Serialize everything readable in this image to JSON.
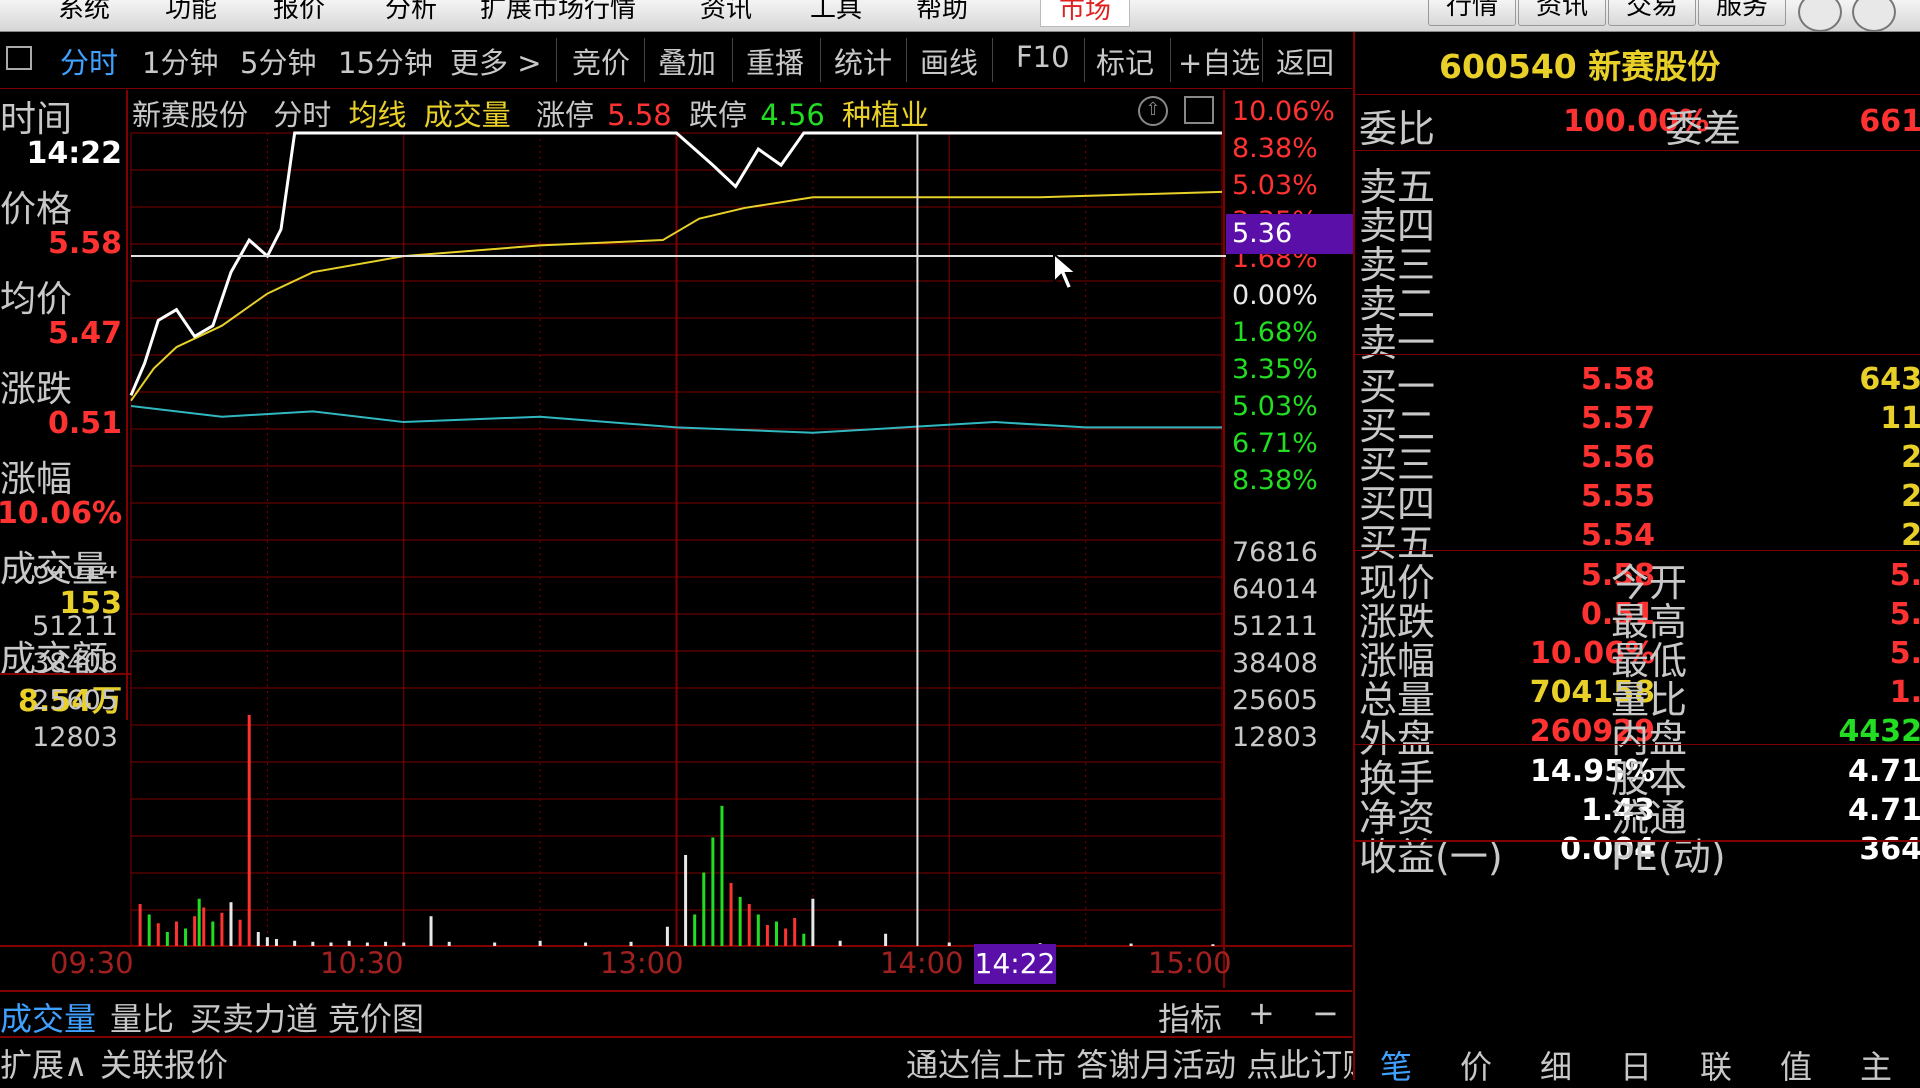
{
  "menubar": {
    "items": [
      "系统",
      "功能",
      "报价",
      "分析",
      "扩展市场行情",
      "资讯",
      "工具",
      "帮助",
      "市场"
    ],
    "right_buttons": [
      "行情",
      "资讯",
      "交易",
      "服务"
    ]
  },
  "toolbar": {
    "items": [
      "分时",
      "1分钟",
      "5分钟",
      "15分钟",
      "更多 >",
      "竞价",
      "叠加",
      "重播",
      "统计",
      "画线",
      "F10",
      "标记",
      "+自选",
      "返回"
    ]
  },
  "left_panel": {
    "time_label": "时间",
    "time_value": "14:22",
    "price_label": "价格",
    "price_value": "5.58",
    "avg_label": "均价",
    "avg_value": "5.47",
    "change_label": "涨跌",
    "change_value": "0.51",
    "pct_label": "涨幅",
    "pct_value": "10.06%",
    "vol_label": "成交量",
    "vol_value": "153",
    "amt_label": "成交额",
    "amt_value": "8.54万"
  },
  "chart_header": {
    "name": "新赛股份",
    "mode": "分时",
    "avg_line": "均线",
    "volume": "成交量",
    "limit_up_label": "涨停",
    "limit_up_value": "5.58",
    "limit_down_label": "跌停",
    "limit_down_value": "4.56",
    "industry": "种植业"
  },
  "cursor_price_label": "5.36",
  "cursor_time_label": "14:22",
  "price_axis_pcts": [
    {
      "text": "10.06%",
      "color": "red"
    },
    {
      "text": "8.38%",
      "color": "red"
    },
    {
      "text": "5.03%",
      "color": "red"
    },
    {
      "text": "3.35%",
      "color": "red"
    },
    {
      "text": "1.68%",
      "color": "red"
    },
    {
      "text": "0.00%",
      "color": "white"
    },
    {
      "text": "1.68%",
      "color": "green"
    },
    {
      "text": "3.35%",
      "color": "green"
    },
    {
      "text": "5.03%",
      "color": "green"
    },
    {
      "text": "6.71%",
      "color": "green"
    },
    {
      "text": "8.38%",
      "color": "green"
    }
  ],
  "volume_axis_right": [
    "76816",
    "64014",
    "51211",
    "38408",
    "25605",
    "12803"
  ],
  "volume_axis_left": [
    "64014",
    "51211",
    "38408",
    "25605",
    "12803"
  ],
  "time_axis": [
    "09:30",
    "10:30",
    "13:00",
    "14:00",
    "15:00"
  ],
  "bottom_tabs": [
    "成交量",
    "量比",
    "买卖力道",
    "竞价图"
  ],
  "bottom_right": {
    "indicator": "指标",
    "plus": "+",
    "minus": "−"
  },
  "status_bar": {
    "expand": "扩展∧",
    "related": "关联报价",
    "ad": "通达信上市 答谢月活动 点此订购"
  },
  "right_panel": {
    "code": "600540",
    "name": "新赛股份",
    "ratio_label": "委比",
    "ratio_value": "100.00%",
    "diff_label": "委差",
    "diff_value": "661",
    "sells": [
      "卖五",
      "卖四",
      "卖三",
      "卖二",
      "卖一"
    ],
    "buys": [
      {
        "label": "买一",
        "price": "5.58",
        "vol": "643"
      },
      {
        "label": "买二",
        "price": "5.57",
        "vol": "11"
      },
      {
        "label": "买三",
        "price": "5.56",
        "vol": "2"
      },
      {
        "label": "买四",
        "price": "5.55",
        "vol": "2"
      },
      {
        "label": "买五",
        "price": "5.54",
        "vol": "2"
      }
    ],
    "stats": [
      {
        "l1": "现价",
        "v1": "5.58",
        "l2": "今开",
        "v2": "5.",
        "c1": "red",
        "c2": "red"
      },
      {
        "l1": "涨跌",
        "v1": "0.51",
        "l2": "最高",
        "v2": "5.",
        "c1": "red",
        "c2": "red"
      },
      {
        "l1": "涨幅",
        "v1": "10.06%",
        "l2": "最低",
        "v2": "5.",
        "c1": "red",
        "c2": "red"
      },
      {
        "l1": "总量",
        "v1": "704158",
        "l2": "量比",
        "v2": "1.",
        "c1": "yellow",
        "c2": "red"
      },
      {
        "l1": "外盘",
        "v1": "260929",
        "l2": "内盘",
        "v2": "4432",
        "c1": "red",
        "c2": "green"
      }
    ],
    "fund": [
      {
        "l1": "换手",
        "v1": "14.95%",
        "l2": "股本",
        "v2": "4.71"
      },
      {
        "l1": "净资",
        "v1": "1.43",
        "l2": "流通",
        "v2": "4.71"
      },
      {
        "l1": "收益(一)",
        "v1": "0.004",
        "l2": "PE(动)",
        "v2": "364"
      }
    ],
    "bottom_tabs": [
      "笔",
      "价",
      "细",
      "日",
      "联",
      "值",
      "主"
    ]
  },
  "chart_data": {
    "type": "line",
    "title": "",
    "prev_close": 5.07,
    "ylim": [
      4.56,
      5.58
    ],
    "x_ticks": [
      "09:30",
      "10:30",
      "13:00",
      "14:00",
      "15:00"
    ],
    "series": [
      {
        "name": "",
        "color": "#ffffff",
        "points": [
          [
            0,
            5.09
          ],
          [
            3,
            5.15
          ],
          [
            6,
            5.23
          ],
          [
            10,
            5.25
          ],
          [
            14,
            5.2
          ],
          [
            18,
            5.22
          ],
          [
            22,
            5.32
          ],
          [
            26,
            5.38
          ],
          [
            30,
            5.35
          ],
          [
            33,
            5.4
          ],
          [
            36,
            5.58
          ],
          [
            60,
            5.58
          ],
          [
            120,
            5.58
          ],
          [
            128,
            5.52
          ],
          [
            133,
            5.48
          ],
          [
            138,
            5.55
          ],
          [
            143,
            5.52
          ],
          [
            148,
            5.58
          ],
          [
            240,
            5.58
          ]
        ]
      },
      {
        "name": "均线",
        "color": "#e8d028",
        "points": [
          [
            0,
            5.08
          ],
          [
            5,
            5.14
          ],
          [
            10,
            5.18
          ],
          [
            20,
            5.22
          ],
          [
            30,
            5.28
          ],
          [
            40,
            5.32
          ],
          [
            60,
            5.35
          ],
          [
            90,
            5.37
          ],
          [
            117,
            5.38
          ],
          [
            125,
            5.42
          ],
          [
            135,
            5.44
          ],
          [
            150,
            5.46
          ],
          [
            200,
            5.46
          ],
          [
            240,
            5.47
          ]
        ]
      }
    ],
    "index_series": {
      "color": "#30b8c0",
      "points": [
        [
          0,
          5.07
        ],
        [
          20,
          5.05
        ],
        [
          40,
          5.06
        ],
        [
          60,
          5.04
        ],
        [
          90,
          5.05
        ],
        [
          120,
          5.03
        ],
        [
          150,
          5.02
        ],
        [
          170,
          5.03
        ],
        [
          190,
          5.04
        ],
        [
          210,
          5.03
        ],
        [
          240,
          5.03
        ]
      ]
    },
    "volume": {
      "ylim": [
        0,
        76816
      ],
      "bars": [
        [
          2,
          12000,
          "r"
        ],
        [
          4,
          9000,
          "g"
        ],
        [
          6,
          6500,
          "r"
        ],
        [
          8,
          4000,
          "g"
        ],
        [
          10,
          7000,
          "r"
        ],
        [
          12,
          5000,
          "g"
        ],
        [
          14,
          8500,
          "r"
        ],
        [
          15,
          13500,
          "g"
        ],
        [
          16,
          11000,
          "r"
        ],
        [
          18,
          7000,
          "g"
        ],
        [
          20,
          9500,
          "r"
        ],
        [
          22,
          12500,
          "w"
        ],
        [
          24,
          7500,
          "r"
        ],
        [
          26,
          66000,
          "r"
        ],
        [
          28,
          4000,
          "w"
        ],
        [
          30,
          2500,
          "w"
        ],
        [
          32,
          2000,
          "w"
        ],
        [
          36,
          1500,
          "w"
        ],
        [
          40,
          1200,
          "w"
        ],
        [
          44,
          1000,
          "w"
        ],
        [
          48,
          1500,
          "w"
        ],
        [
          52,
          1000,
          "w"
        ],
        [
          56,
          1200,
          "w"
        ],
        [
          60,
          1000,
          "w"
        ],
        [
          66,
          8500,
          "w"
        ],
        [
          70,
          1200,
          "w"
        ],
        [
          80,
          1000,
          "w"
        ],
        [
          90,
          1500,
          "w"
        ],
        [
          100,
          1000,
          "w"
        ],
        [
          110,
          1200,
          "w"
        ],
        [
          118,
          5500,
          "w"
        ],
        [
          122,
          26000,
          "w"
        ],
        [
          124,
          9000,
          "g"
        ],
        [
          126,
          21000,
          "g"
        ],
        [
          128,
          31000,
          "g"
        ],
        [
          130,
          40000,
          "g"
        ],
        [
          132,
          18000,
          "r"
        ],
        [
          134,
          14000,
          "g"
        ],
        [
          136,
          12000,
          "r"
        ],
        [
          138,
          9000,
          "g"
        ],
        [
          140,
          6000,
          "r"
        ],
        [
          142,
          7000,
          "g"
        ],
        [
          144,
          5000,
          "r"
        ],
        [
          146,
          8000,
          "r"
        ],
        [
          148,
          3500,
          "g"
        ],
        [
          150,
          13500,
          "w"
        ],
        [
          156,
          1500,
          "w"
        ],
        [
          166,
          3500,
          "w"
        ],
        [
          180,
          1000,
          "w"
        ],
        [
          200,
          800,
          "w"
        ],
        [
          220,
          700,
          "w"
        ],
        [
          238,
          500,
          "w"
        ]
      ]
    }
  }
}
